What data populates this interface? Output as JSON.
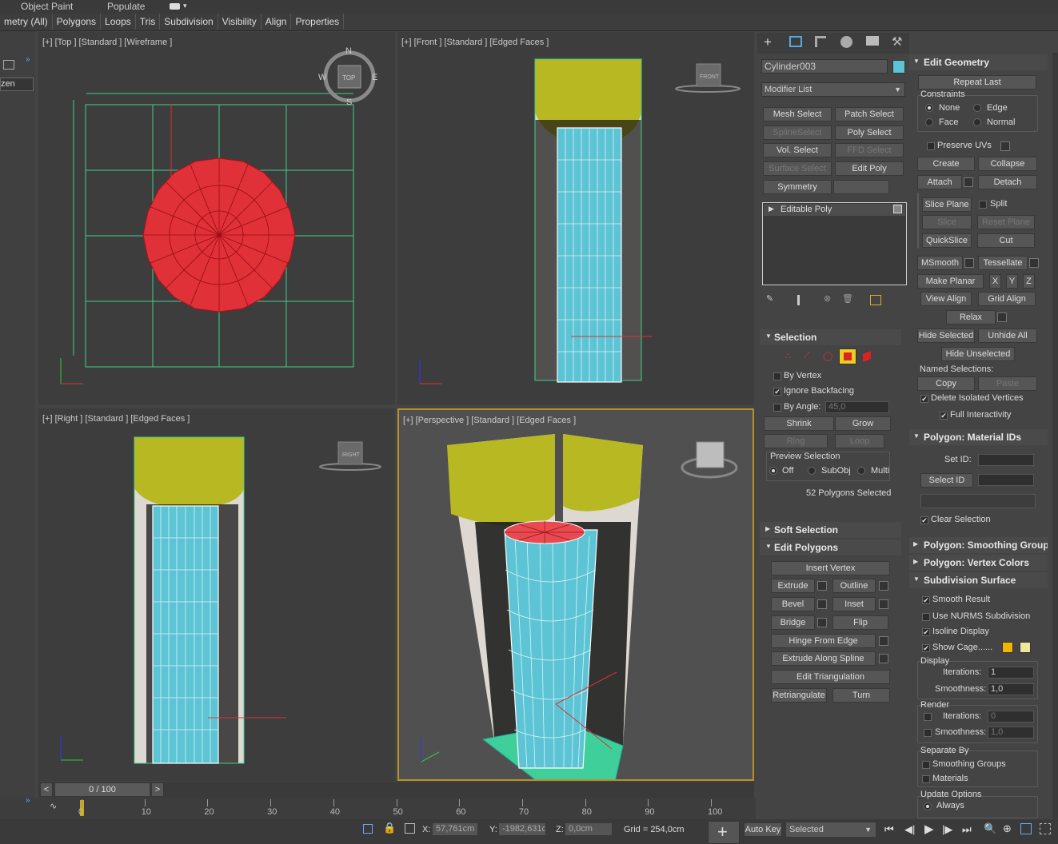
{
  "top_menu": {
    "object_paint": "Object Paint",
    "populate": "Populate"
  },
  "ribbon_tabs": [
    "metry (All)",
    "Polygons",
    "Loops",
    "Tris",
    "Subdivision",
    "Visibility",
    "Align",
    "Properties"
  ],
  "left_strip": {
    "label": "zen"
  },
  "viewports": {
    "top": {
      "label": "[+] [Top ] [Standard ] [Wireframe ]",
      "compass": {
        "n": "N",
        "s": "S",
        "e": "E",
        "w": "W",
        "center": "TOP"
      }
    },
    "front": {
      "label": "[+] [Front ] [Standard ] [Edged Faces ]",
      "cube": "FRONT"
    },
    "right": {
      "label": "[+] [Right ] [Standard ] [Edged Faces ]",
      "cube": "RIGHT"
    },
    "persp": {
      "label": "[+] [Perspective ] [Standard ] [Edged Faces ]"
    }
  },
  "command_panel": {
    "object_name": "Cylinder003",
    "object_color": "#5cc4d4",
    "modifier_list": "Modifier List",
    "modifier_buttons": [
      {
        "label": "Mesh Select",
        "enabled": true
      },
      {
        "label": "Patch Select",
        "enabled": true
      },
      {
        "label": "SplineSelect",
        "enabled": false
      },
      {
        "label": "Poly Select",
        "enabled": true
      },
      {
        "label": "Vol. Select",
        "enabled": true
      },
      {
        "label": "FFD Select",
        "enabled": false
      },
      {
        "label": "Surface Select",
        "enabled": false
      },
      {
        "label": "Edit Poly",
        "enabled": true
      },
      {
        "label": "Symmetry",
        "enabled": true
      },
      {
        "label": "",
        "enabled": true
      }
    ],
    "stack_item": "Editable Poly",
    "selection": {
      "title": "Selection",
      "by_vertex": "By Vertex",
      "ignore_backfacing": "Ignore Backfacing",
      "by_angle": "By Angle:",
      "angle_value": "45,0",
      "shrink": "Shrink",
      "grow": "Grow",
      "ring": "Ring",
      "loop": "Loop",
      "preview_title": "Preview Selection",
      "preview_off": "Off",
      "preview_subobj": "SubObj",
      "preview_multi": "Multi",
      "status": "52 Polygons Selected"
    },
    "soft_selection": "Soft Selection",
    "edit_polygons": {
      "title": "Edit Polygons",
      "insert_vertex": "Insert Vertex",
      "extrude": "Extrude",
      "outline": "Outline",
      "bevel": "Bevel",
      "inset": "Inset",
      "bridge": "Bridge",
      "flip": "Flip",
      "hinge": "Hinge From Edge",
      "extrude_spline": "Extrude Along Spline",
      "edit_tri": "Edit Triangulation",
      "retri": "Retriangulate",
      "turn": "Turn"
    }
  },
  "edit_geometry": {
    "title": "Edit Geometry",
    "repeat_last": "Repeat Last",
    "constraints": "Constraints",
    "none": "None",
    "edge": "Edge",
    "face": "Face",
    "normal": "Normal",
    "preserve_uvs": "Preserve UVs",
    "create": "Create",
    "collapse": "Collapse",
    "attach": "Attach",
    "detach": "Detach",
    "slice_plane": "Slice Plane",
    "split": "Split",
    "slice": "Slice",
    "reset_plane": "Reset Plane",
    "quickslice": "QuickSlice",
    "cut": "Cut",
    "msmooth": "MSmooth",
    "tessellate": "Tessellate",
    "make_planar": "Make Planar",
    "x": "X",
    "y": "Y",
    "z": "Z",
    "view_align": "View Align",
    "grid_align": "Grid Align",
    "relax": "Relax",
    "hide_selected": "Hide Selected",
    "unhide_all": "Unhide All",
    "hide_unselected": "Hide Unselected",
    "named_selections": "Named Selections:",
    "copy": "Copy",
    "paste": "Paste",
    "delete_isolated": "Delete Isolated Vertices",
    "full_interactivity": "Full Interactivity"
  },
  "material_ids": {
    "title": "Polygon: Material IDs",
    "set_id": "Set ID:",
    "select_id": "Select ID",
    "clear_selection": "Clear Selection"
  },
  "smoothing_groups": "Polygon: Smoothing Groups",
  "vertex_colors": "Polygon: Vertex Colors",
  "subdivision": {
    "title": "Subdivision Surface",
    "smooth_result": "Smooth Result",
    "use_nurms": "Use NURMS Subdivision",
    "isoline": "Isoline Display",
    "show_cage": "Show Cage......",
    "cage_color1": "#f5b400",
    "cage_color2": "#efe89a",
    "display": "Display",
    "iterations": "Iterations:",
    "iter_val": "1",
    "smoothness": "Smoothness:",
    "smooth_val": "1,0",
    "render": "Render",
    "r_iter_val": "0",
    "r_smooth_val": "1,0",
    "separate_by": "Separate By",
    "sep_smoothing": "Smoothing Groups",
    "sep_materials": "Materials",
    "update_options": "Update Options",
    "always": "Always"
  },
  "timeline": {
    "frame": "0 / 100",
    "ticks": [
      "0",
      "10",
      "20",
      "30",
      "40",
      "50",
      "60",
      "70",
      "80",
      "90",
      "100"
    ]
  },
  "status_bar": {
    "x_label": "X:",
    "x_val": "57,761cm",
    "y_label": "Y:",
    "y_val": "-1982,631c",
    "z_label": "Z:",
    "z_val": "0,0cm",
    "grid": "Grid = 254,0cm",
    "auto_key": "Auto Key",
    "selected": "Selected"
  }
}
